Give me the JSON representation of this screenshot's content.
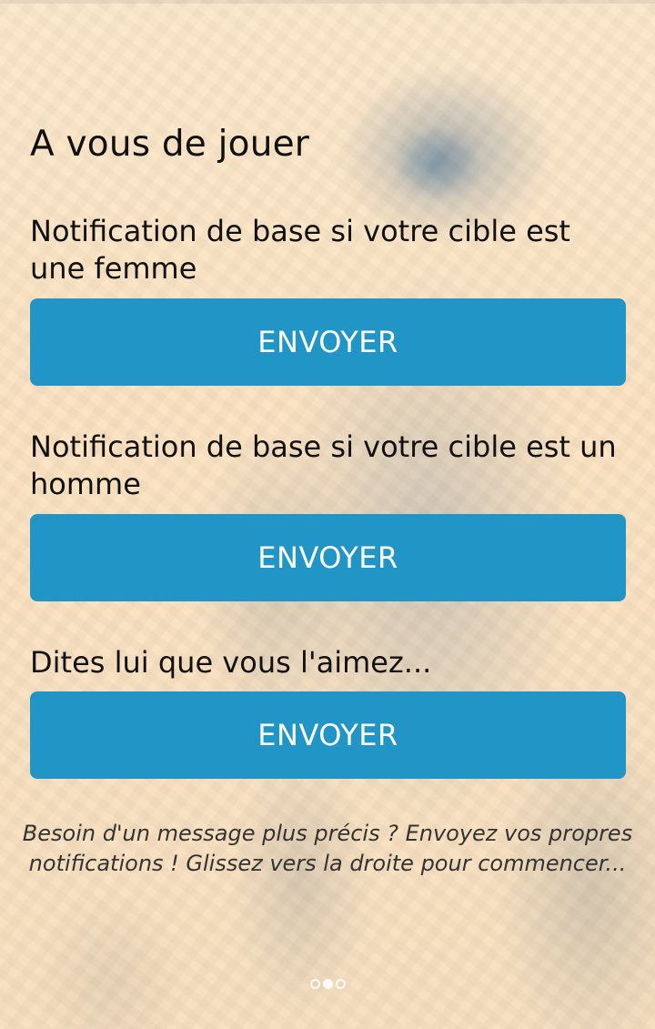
{
  "title": "A vous de jouer",
  "sections": [
    {
      "label": "Notification de base si votre cible est une femme",
      "button": "ENVOYER"
    },
    {
      "label": "Notification de base si votre cible est un homme",
      "button": "ENVOYER"
    },
    {
      "label": "Dites lui que vous l'aimez...",
      "button": "ENVOYER"
    }
  ],
  "hint": "Besoin d'un message plus précis ? Envoyez vos propres notifications ! Glissez vers la droite pour commencer...",
  "pager": {
    "total": 3,
    "active": 2
  },
  "colors": {
    "button": "#2196c6",
    "button_text": "#ffffff",
    "background": "#fbe6c8"
  }
}
